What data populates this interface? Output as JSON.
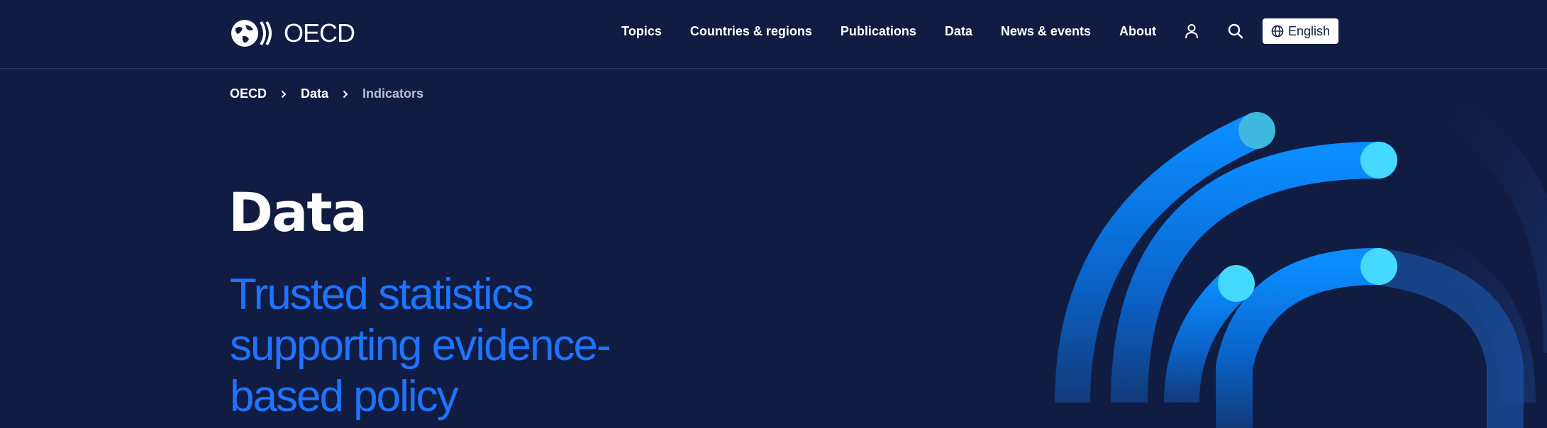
{
  "header": {
    "logo_text": "OECD",
    "nav": [
      "Topics",
      "Countries & regions",
      "Publications",
      "Data",
      "News & events",
      "About"
    ],
    "account_icon": "user-icon",
    "search_icon": "search-icon",
    "language_icon": "globe-icon",
    "language_label": "English"
  },
  "breadcrumb": {
    "items": [
      "OECD",
      "Data",
      "Indicators"
    ]
  },
  "hero": {
    "title": "Data",
    "subtitle": "Trusted statistics supporting evidence-based policy"
  },
  "colors": {
    "background": "#111c42",
    "accent_blue": "#1f73ff",
    "arc_blue": "#0b8cff",
    "dot_cyan": "#45d9ff"
  }
}
